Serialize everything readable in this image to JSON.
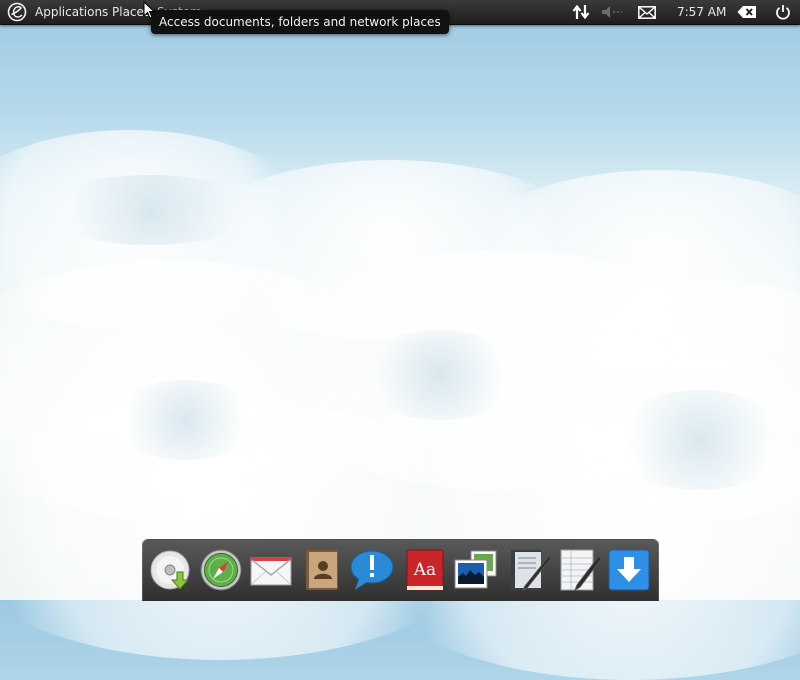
{
  "panel": {
    "menus": {
      "applications": "Applications",
      "places": "Places",
      "system": "System"
    },
    "clock": "7:57 AM",
    "tray_icons": [
      "network-updown-icon",
      "volume-muted-icon",
      "mail-icon",
      "user-status-icon",
      "power-icon"
    ]
  },
  "tooltip": {
    "text": "Access documents, folders and network places"
  },
  "dock": {
    "items": [
      "disk-installer-icon",
      "web-browser-icon",
      "mail-app-icon",
      "contacts-icon",
      "chat-icon",
      "dictionary-icon",
      "photos-icon",
      "notes-icon",
      "text-editor-icon",
      "downloads-icon"
    ]
  },
  "dictionary_icon_text": "Aa"
}
